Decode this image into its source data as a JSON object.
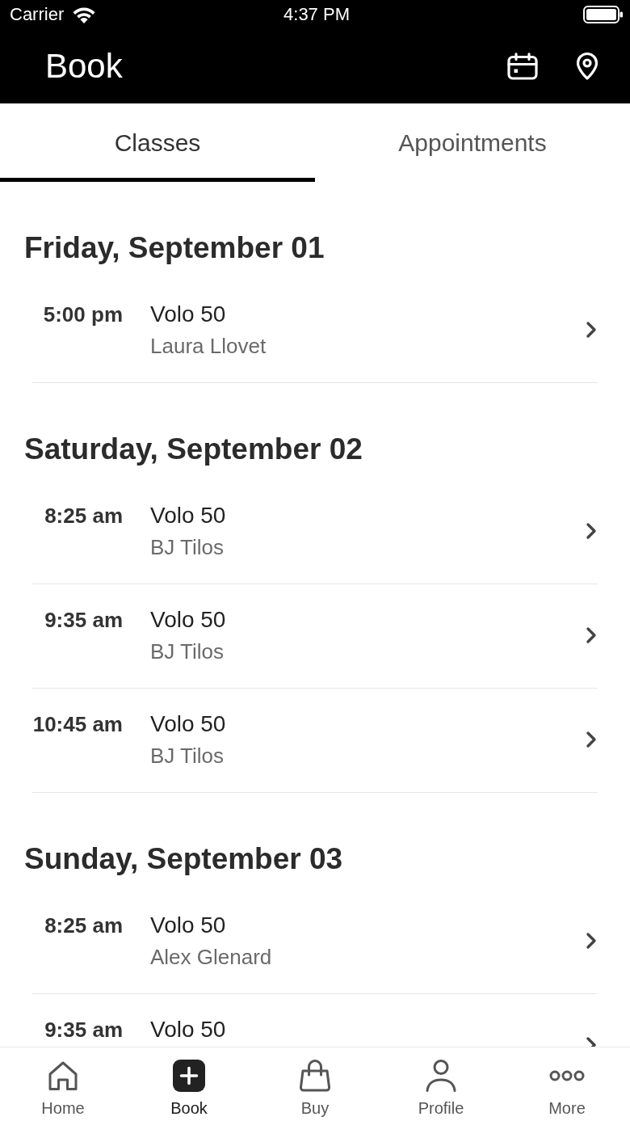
{
  "status_bar": {
    "carrier": "Carrier",
    "time": "4:37 PM"
  },
  "header": {
    "title": "Book"
  },
  "tabs": [
    {
      "label": "Classes",
      "selected": true
    },
    {
      "label": "Appointments",
      "selected": false
    }
  ],
  "days": [
    {
      "date": "Friday, September 01",
      "classes": [
        {
          "time": "5:00 pm",
          "name": "Volo 50",
          "instructor": "Laura Llovet"
        }
      ]
    },
    {
      "date": "Saturday, September 02",
      "classes": [
        {
          "time": "8:25 am",
          "name": "Volo 50",
          "instructor": "BJ Tilos"
        },
        {
          "time": "9:35 am",
          "name": "Volo 50",
          "instructor": "BJ Tilos"
        },
        {
          "time": "10:45 am",
          "name": "Volo 50",
          "instructor": "BJ Tilos"
        }
      ]
    },
    {
      "date": "Sunday, September 03",
      "classes": [
        {
          "time": "8:25 am",
          "name": "Volo 50",
          "instructor": "Alex Glenard"
        },
        {
          "time": "9:35 am",
          "name": "Volo 50"
        }
      ]
    }
  ],
  "tab_bar": [
    {
      "label": "Home",
      "selected": false
    },
    {
      "label": "Book",
      "selected": true
    },
    {
      "label": "Buy",
      "selected": false
    },
    {
      "label": "Profile",
      "selected": false
    },
    {
      "label": "More",
      "selected": false
    }
  ]
}
